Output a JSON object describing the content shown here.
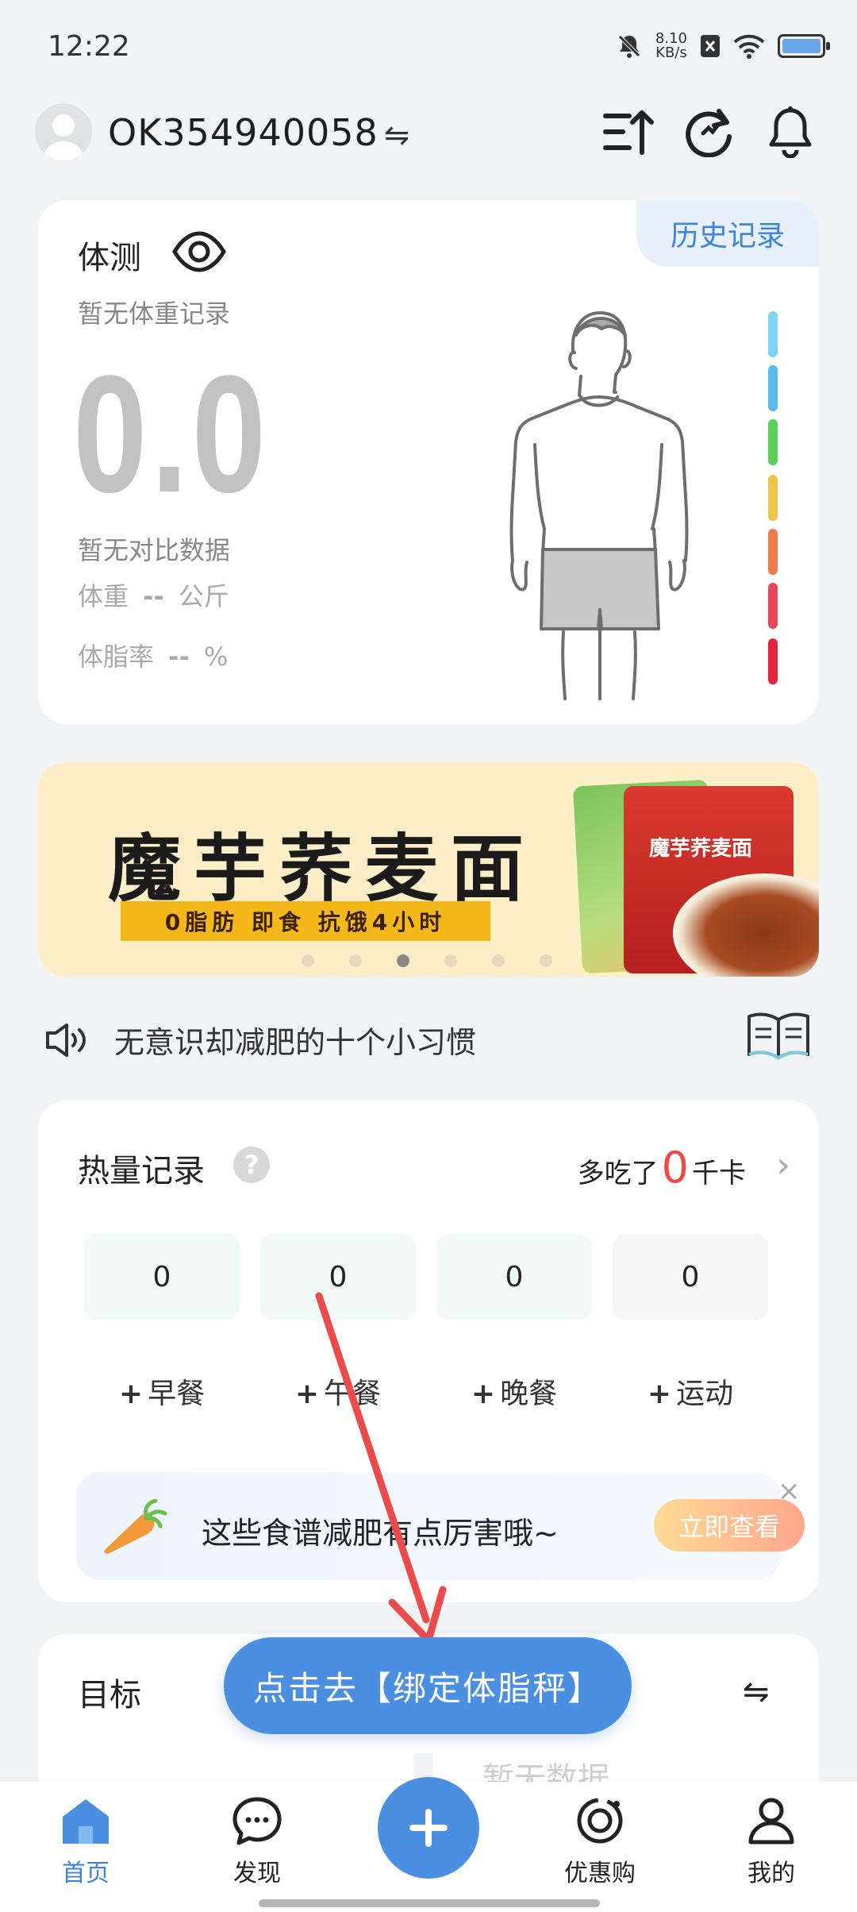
{
  "status_bar": {
    "time": "12:22",
    "net_speed_value": "8.10",
    "net_speed_unit": "KB/s"
  },
  "header": {
    "username": "OK354940058",
    "switch_symbol": "⇋"
  },
  "body_measure": {
    "title": "体测",
    "history_label": "历史记录",
    "no_weight_record": "暂无体重记录",
    "big_value": "0.0",
    "no_compare": "暂无对比数据",
    "weight_label": "体重",
    "weight_value": "--",
    "weight_unit": "公斤",
    "bodyfat_label": "体脂率",
    "bodyfat_value": "--",
    "bodyfat_unit": "%",
    "scale_colors": [
      "#7fd3f5",
      "#5bbbe8",
      "#5ccf58",
      "#eec44b",
      "#ef7a4a",
      "#e9485a",
      "#e3243f"
    ]
  },
  "banner": {
    "title": "魔芋荞麦面",
    "tagline": "0脂肪 即食 抗饿4小时",
    "package_label": "魔芋荞麦面",
    "dots_count": 6,
    "active_dot": 2
  },
  "tip": {
    "text": "无意识却减肥的十个小习惯"
  },
  "calories": {
    "title": "热量记录",
    "help": "?",
    "summary_prefix": "多吃了",
    "summary_value": "0",
    "summary_unit": "千卡",
    "boxes": [
      "0",
      "0",
      "0",
      "0"
    ],
    "meals": [
      "早餐",
      "午餐",
      "晚餐",
      "运动"
    ],
    "plus": "+",
    "recipe_text": "这些食谱减肥有点厉害哦~",
    "recipe_button": "立即查看",
    "recipe_close": "×"
  },
  "goal": {
    "title": "目标",
    "no_data": "暂无数据",
    "switch_symbol": "⇋"
  },
  "cta": {
    "label": "点击去【绑定体脂秤】"
  },
  "bottom_nav": {
    "items": [
      {
        "label": "首页",
        "icon": "home-icon",
        "active": true
      },
      {
        "label": "发现",
        "icon": "chat-bubble-icon",
        "active": false
      },
      {
        "label": "",
        "icon": "add-icon",
        "active": false
      },
      {
        "label": "优惠购",
        "icon": "coupon-icon",
        "active": false
      },
      {
        "label": "我的",
        "icon": "person-icon",
        "active": false
      }
    ]
  },
  "colors": {
    "accent": "#4a8fe2",
    "history_text": "#3d83e0",
    "calorie_highlight": "#f04a46",
    "annotation_arrow": "#ec4b4b"
  }
}
